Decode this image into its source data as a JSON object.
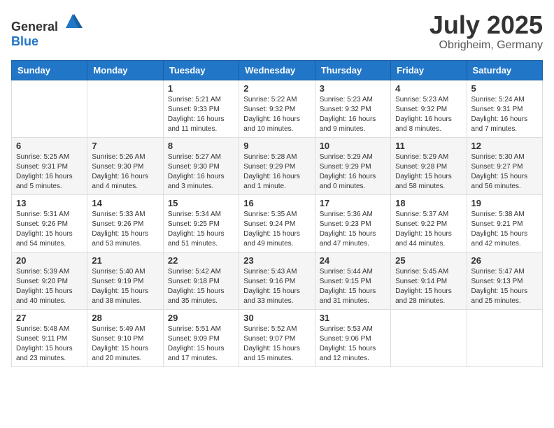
{
  "header": {
    "logo_general": "General",
    "logo_blue": "Blue",
    "month_title": "July 2025",
    "location": "Obrigheim, Germany"
  },
  "weekdays": [
    "Sunday",
    "Monday",
    "Tuesday",
    "Wednesday",
    "Thursday",
    "Friday",
    "Saturday"
  ],
  "weeks": [
    [
      {
        "day": "",
        "sunrise": "",
        "sunset": "",
        "daylight": ""
      },
      {
        "day": "",
        "sunrise": "",
        "sunset": "",
        "daylight": ""
      },
      {
        "day": "1",
        "sunrise": "Sunrise: 5:21 AM",
        "sunset": "Sunset: 9:33 PM",
        "daylight": "Daylight: 16 hours and 11 minutes."
      },
      {
        "day": "2",
        "sunrise": "Sunrise: 5:22 AM",
        "sunset": "Sunset: 9:32 PM",
        "daylight": "Daylight: 16 hours and 10 minutes."
      },
      {
        "day": "3",
        "sunrise": "Sunrise: 5:23 AM",
        "sunset": "Sunset: 9:32 PM",
        "daylight": "Daylight: 16 hours and 9 minutes."
      },
      {
        "day": "4",
        "sunrise": "Sunrise: 5:23 AM",
        "sunset": "Sunset: 9:32 PM",
        "daylight": "Daylight: 16 hours and 8 minutes."
      },
      {
        "day": "5",
        "sunrise": "Sunrise: 5:24 AM",
        "sunset": "Sunset: 9:31 PM",
        "daylight": "Daylight: 16 hours and 7 minutes."
      }
    ],
    [
      {
        "day": "6",
        "sunrise": "Sunrise: 5:25 AM",
        "sunset": "Sunset: 9:31 PM",
        "daylight": "Daylight: 16 hours and 5 minutes."
      },
      {
        "day": "7",
        "sunrise": "Sunrise: 5:26 AM",
        "sunset": "Sunset: 9:30 PM",
        "daylight": "Daylight: 16 hours and 4 minutes."
      },
      {
        "day": "8",
        "sunrise": "Sunrise: 5:27 AM",
        "sunset": "Sunset: 9:30 PM",
        "daylight": "Daylight: 16 hours and 3 minutes."
      },
      {
        "day": "9",
        "sunrise": "Sunrise: 5:28 AM",
        "sunset": "Sunset: 9:29 PM",
        "daylight": "Daylight: 16 hours and 1 minute."
      },
      {
        "day": "10",
        "sunrise": "Sunrise: 5:29 AM",
        "sunset": "Sunset: 9:29 PM",
        "daylight": "Daylight: 16 hours and 0 minutes."
      },
      {
        "day": "11",
        "sunrise": "Sunrise: 5:29 AM",
        "sunset": "Sunset: 9:28 PM",
        "daylight": "Daylight: 15 hours and 58 minutes."
      },
      {
        "day": "12",
        "sunrise": "Sunrise: 5:30 AM",
        "sunset": "Sunset: 9:27 PM",
        "daylight": "Daylight: 15 hours and 56 minutes."
      }
    ],
    [
      {
        "day": "13",
        "sunrise": "Sunrise: 5:31 AM",
        "sunset": "Sunset: 9:26 PM",
        "daylight": "Daylight: 15 hours and 54 minutes."
      },
      {
        "day": "14",
        "sunrise": "Sunrise: 5:33 AM",
        "sunset": "Sunset: 9:26 PM",
        "daylight": "Daylight: 15 hours and 53 minutes."
      },
      {
        "day": "15",
        "sunrise": "Sunrise: 5:34 AM",
        "sunset": "Sunset: 9:25 PM",
        "daylight": "Daylight: 15 hours and 51 minutes."
      },
      {
        "day": "16",
        "sunrise": "Sunrise: 5:35 AM",
        "sunset": "Sunset: 9:24 PM",
        "daylight": "Daylight: 15 hours and 49 minutes."
      },
      {
        "day": "17",
        "sunrise": "Sunrise: 5:36 AM",
        "sunset": "Sunset: 9:23 PM",
        "daylight": "Daylight: 15 hours and 47 minutes."
      },
      {
        "day": "18",
        "sunrise": "Sunrise: 5:37 AM",
        "sunset": "Sunset: 9:22 PM",
        "daylight": "Daylight: 15 hours and 44 minutes."
      },
      {
        "day": "19",
        "sunrise": "Sunrise: 5:38 AM",
        "sunset": "Sunset: 9:21 PM",
        "daylight": "Daylight: 15 hours and 42 minutes."
      }
    ],
    [
      {
        "day": "20",
        "sunrise": "Sunrise: 5:39 AM",
        "sunset": "Sunset: 9:20 PM",
        "daylight": "Daylight: 15 hours and 40 minutes."
      },
      {
        "day": "21",
        "sunrise": "Sunrise: 5:40 AM",
        "sunset": "Sunset: 9:19 PM",
        "daylight": "Daylight: 15 hours and 38 minutes."
      },
      {
        "day": "22",
        "sunrise": "Sunrise: 5:42 AM",
        "sunset": "Sunset: 9:18 PM",
        "daylight": "Daylight: 15 hours and 35 minutes."
      },
      {
        "day": "23",
        "sunrise": "Sunrise: 5:43 AM",
        "sunset": "Sunset: 9:16 PM",
        "daylight": "Daylight: 15 hours and 33 minutes."
      },
      {
        "day": "24",
        "sunrise": "Sunrise: 5:44 AM",
        "sunset": "Sunset: 9:15 PM",
        "daylight": "Daylight: 15 hours and 31 minutes."
      },
      {
        "day": "25",
        "sunrise": "Sunrise: 5:45 AM",
        "sunset": "Sunset: 9:14 PM",
        "daylight": "Daylight: 15 hours and 28 minutes."
      },
      {
        "day": "26",
        "sunrise": "Sunrise: 5:47 AM",
        "sunset": "Sunset: 9:13 PM",
        "daylight": "Daylight: 15 hours and 25 minutes."
      }
    ],
    [
      {
        "day": "27",
        "sunrise": "Sunrise: 5:48 AM",
        "sunset": "Sunset: 9:11 PM",
        "daylight": "Daylight: 15 hours and 23 minutes."
      },
      {
        "day": "28",
        "sunrise": "Sunrise: 5:49 AM",
        "sunset": "Sunset: 9:10 PM",
        "daylight": "Daylight: 15 hours and 20 minutes."
      },
      {
        "day": "29",
        "sunrise": "Sunrise: 5:51 AM",
        "sunset": "Sunset: 9:09 PM",
        "daylight": "Daylight: 15 hours and 17 minutes."
      },
      {
        "day": "30",
        "sunrise": "Sunrise: 5:52 AM",
        "sunset": "Sunset: 9:07 PM",
        "daylight": "Daylight: 15 hours and 15 minutes."
      },
      {
        "day": "31",
        "sunrise": "Sunrise: 5:53 AM",
        "sunset": "Sunset: 9:06 PM",
        "daylight": "Daylight: 15 hours and 12 minutes."
      },
      {
        "day": "",
        "sunrise": "",
        "sunset": "",
        "daylight": ""
      },
      {
        "day": "",
        "sunrise": "",
        "sunset": "",
        "daylight": ""
      }
    ]
  ]
}
